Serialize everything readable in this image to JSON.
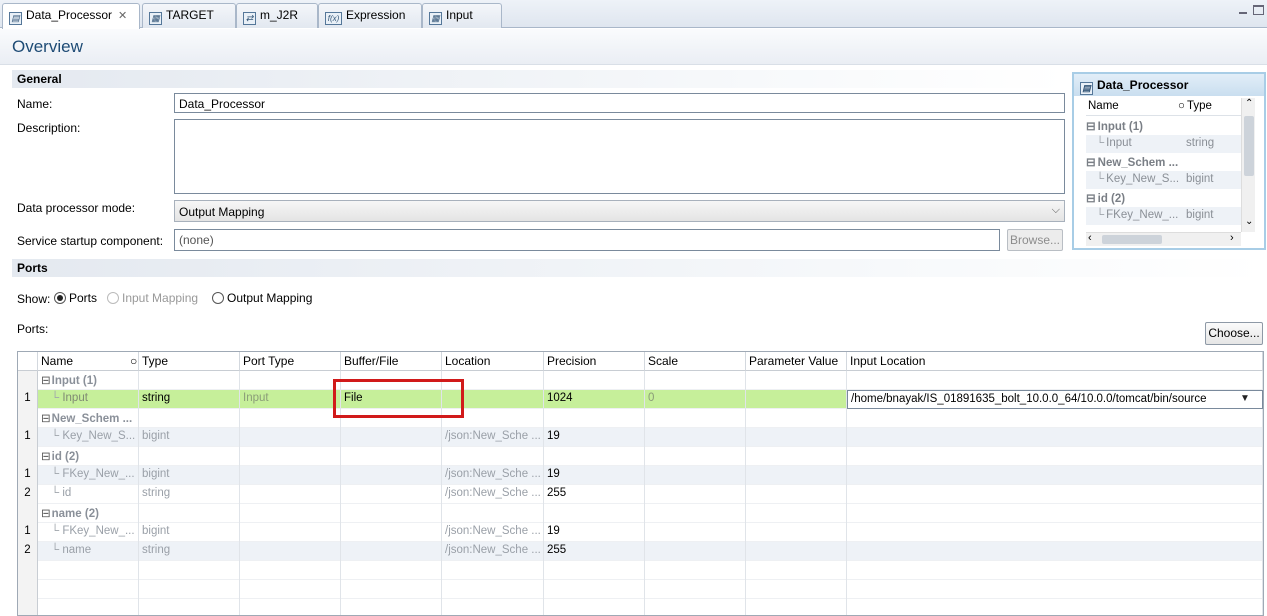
{
  "tabs": [
    {
      "label": "Data_Processor",
      "icon": "data-processor-icon",
      "active": true
    },
    {
      "label": "TARGET",
      "icon": "table-icon"
    },
    {
      "label": "m_J2R",
      "icon": "mapping-icon"
    },
    {
      "label": "Expression",
      "icon": "function-icon",
      "icon_text": "f(x)"
    },
    {
      "label": "Input",
      "icon": "table-icon"
    }
  ],
  "overview": {
    "title": "Overview"
  },
  "general": {
    "header": "General",
    "name_label": "Name:",
    "name_value": "Data_Processor",
    "description_label": "Description:",
    "description_value": "",
    "mode_label": "Data processor mode:",
    "mode_value": "Output Mapping",
    "startup_label": "Service startup component:",
    "startup_value": "(none)",
    "browse_label": "Browse..."
  },
  "mini_panel": {
    "title": "Data_Processor",
    "col_name": "Name",
    "col_type": "Type",
    "rows": [
      {
        "name": "Input (1)",
        "type": "",
        "kind": "group"
      },
      {
        "name": "Input",
        "type": "string",
        "kind": "child"
      },
      {
        "name": "New_Schem ...",
        "type": "",
        "kind": "group"
      },
      {
        "name": "Key_New_S...",
        "type": "bigint",
        "kind": "child"
      },
      {
        "name": "id (2)",
        "type": "",
        "kind": "group"
      },
      {
        "name": "FKey_New_...",
        "type": "bigint",
        "kind": "child"
      }
    ]
  },
  "ports": {
    "header": "Ports",
    "show_label": "Show:",
    "options": [
      {
        "label": "Ports",
        "selected": true,
        "enabled": true
      },
      {
        "label": "Input Mapping",
        "selected": false,
        "enabled": false
      },
      {
        "label": "Output Mapping",
        "selected": false,
        "enabled": true
      }
    ],
    "ports_label": "Ports:",
    "choose_label": "Choose..."
  },
  "grid": {
    "columns": [
      "Name",
      "Type",
      "Port Type",
      "Buffer/File",
      "Location",
      "Precision",
      "Scale",
      "Parameter Value",
      "Input Location"
    ],
    "rows": [
      {
        "num": "",
        "name": "Input (1)",
        "kind": "group"
      },
      {
        "num": "1",
        "name": "Input",
        "type": "string",
        "port_type": "Input",
        "buffer": "File",
        "location": "",
        "precision": "1024",
        "scale": "0",
        "param": "",
        "input_location": "/home/bnayak/IS_01891635_bolt_10.0.0_64/10.0.0/tomcat/bin/source",
        "kind": "selected"
      },
      {
        "num": "",
        "name": "New_Schem ...",
        "kind": "group"
      },
      {
        "num": "1",
        "name": "Key_New_S...",
        "type": "bigint",
        "port_type": "",
        "buffer": "",
        "location": "/json:New_Sche ...",
        "precision": "19",
        "scale": "",
        "param": "",
        "input_location": "",
        "kind": "child"
      },
      {
        "num": "",
        "name": "id (2)",
        "kind": "group"
      },
      {
        "num": "1",
        "name": "FKey_New_...",
        "type": "bigint",
        "port_type": "",
        "buffer": "",
        "location": "/json:New_Sche ...",
        "precision": "19",
        "scale": "",
        "param": "",
        "input_location": "",
        "kind": "child"
      },
      {
        "num": "2",
        "name": "id",
        "type": "string",
        "port_type": "",
        "buffer": "",
        "location": "/json:New_Sche ...",
        "precision": "255",
        "scale": "",
        "param": "",
        "input_location": "",
        "kind": "child"
      },
      {
        "num": "",
        "name": "name (2)",
        "kind": "group"
      },
      {
        "num": "1",
        "name": "FKey_New_...",
        "type": "bigint",
        "port_type": "",
        "buffer": "",
        "location": "/json:New_Sche ...",
        "precision": "19",
        "scale": "",
        "param": "",
        "input_location": "",
        "kind": "child"
      },
      {
        "num": "2",
        "name": "name",
        "type": "string",
        "port_type": "",
        "buffer": "",
        "location": "/json:New_Sche ...",
        "precision": "255",
        "scale": "",
        "param": "",
        "input_location": "",
        "kind": "child"
      }
    ]
  },
  "colors": {
    "selected_row": "#c6ef9a",
    "highlight_box": "#d11a1a",
    "title_blue": "#1e4b75"
  }
}
